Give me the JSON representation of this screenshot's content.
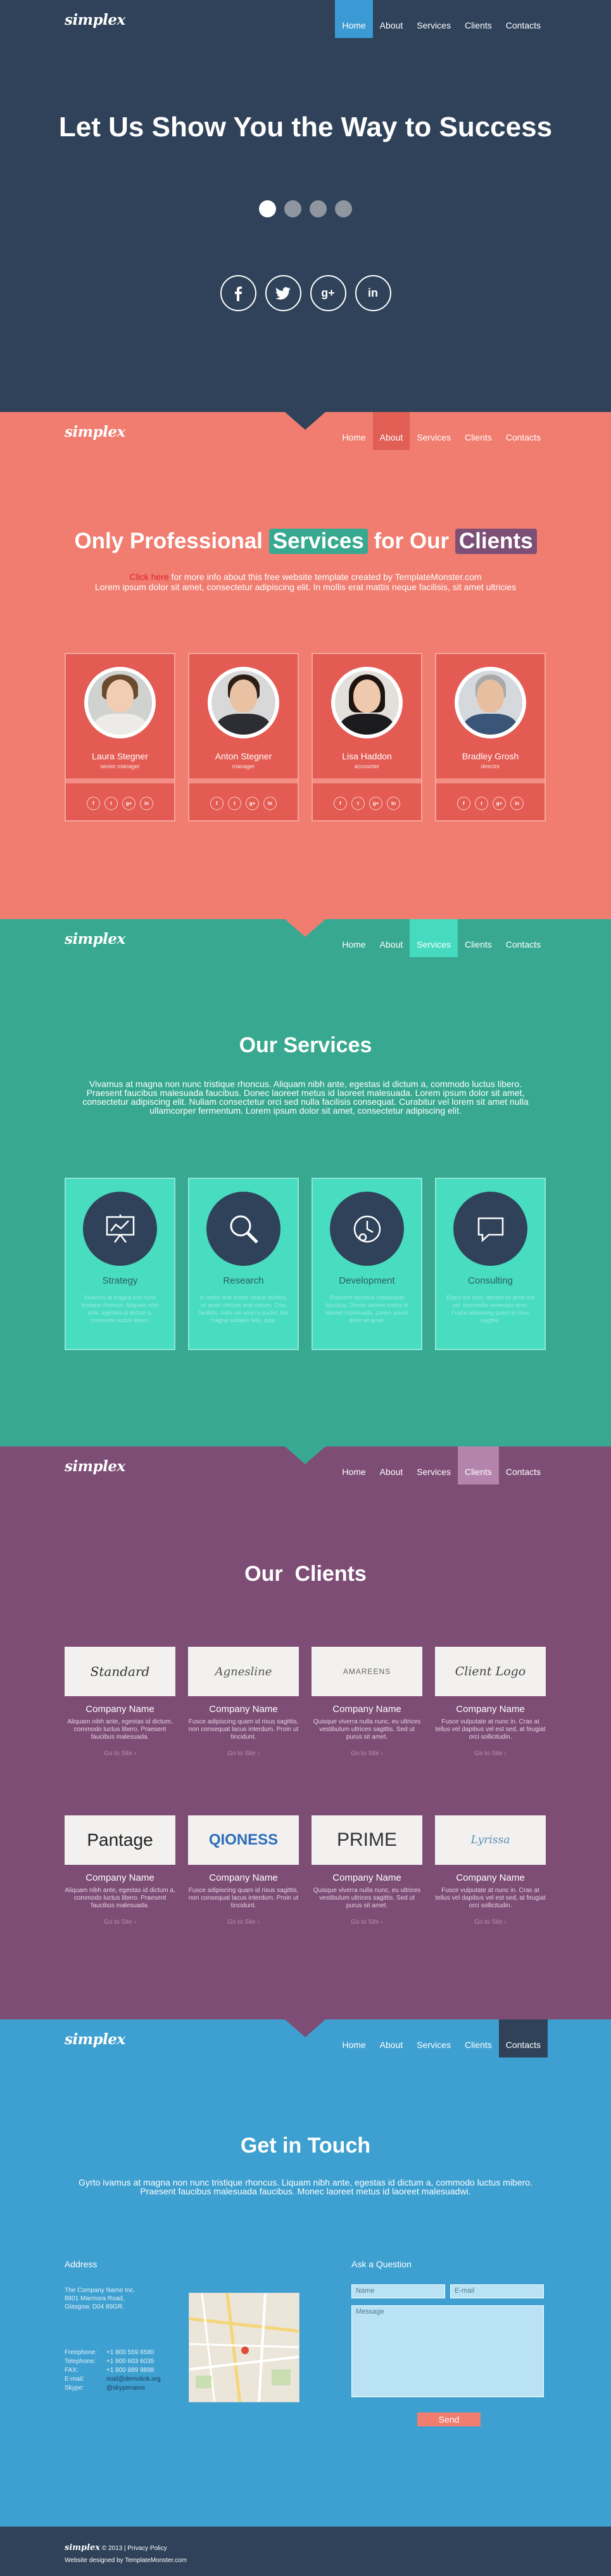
{
  "logo": "simplex",
  "nav": [
    "Home",
    "About",
    "Services",
    "Clients",
    "Contacts"
  ],
  "hero": {
    "title": "Let Us Show You the Way to Success",
    "social": [
      "f",
      "t",
      "g+",
      "in"
    ],
    "slides": 4,
    "active_slide": 1
  },
  "about": {
    "title_pre": "Only Professional ",
    "title_hl1": "Services",
    "title_mid": " for Our ",
    "title_hl2": "Clients",
    "click_here": "Click here",
    "line1": " for more info about this free website template created by TemplateMonster.com",
    "line2": "Lorem ipsum dolor sit amet, consectetur adipiscing elit. In mollis erat mattis neque facilisis, sit amet ultricies",
    "members": [
      {
        "name": "Laura Stegner",
        "role": "senior manager"
      },
      {
        "name": "Anton Stegner",
        "role": "manager"
      },
      {
        "name": "Lisa Haddon",
        "role": "accounter"
      },
      {
        "name": "Bradley Grosh",
        "role": "director"
      }
    ],
    "social": [
      "f",
      "t",
      "g+",
      "in"
    ]
  },
  "services": {
    "title": "Our Services",
    "text": "Vivamus at magna non nunc tristique rhoncus. Aliquam nibh ante, egestas id dictum a, commodo luctus libero. Praesent faucibus malesuada faucibus. Donec laoreet metus id laoreet malesuada. Lorem ipsum dolor sit amet, consectetur adipiscing elit. Nullam consectetur orci sed nulla facilisis consequat. Curabitur vel lorem sit amet nulla ullamcorper fermentum. Lorem ipsum dolor sit amet, consectetur adipiscing elit.",
    "items": [
      {
        "name": "Strategy",
        "icon": "presentation-chart-icon",
        "text": "Vivamus at magna non nunc tristique rhoncus. Aliquam nibh ante, egestas id dictum a, commodo luctus libero."
      },
      {
        "name": "Research",
        "icon": "magnifier-icon",
        "text": "In mollis erat mattis neque facilisis, sit amet ultricies erat rutrum. Cras facilisis, nulla vel viverra auctor, leo magna sodales felis, quis."
      },
      {
        "name": "Development",
        "icon": "clock-icon",
        "text": "Praesent faucibus malesuada faucibus. Donec laoreet metus id laoreet malesuada. Lorem ipsum dolor sit amet."
      },
      {
        "name": "Consulting",
        "icon": "speech-bubble-icon",
        "text": "Etiam dui eros, laoreet sit amet est vel, commodo venenatis eros. Fusce adipiscing quam id risus sagittis."
      }
    ]
  },
  "clients": {
    "title": "Our  Clients",
    "link": "Go to Site",
    "items": [
      {
        "logo": "Standard",
        "name": "Company Name",
        "text": "Aliquam nibh ante, egestas id dictum, commodo luctus libero. Praesent faucibus malesuada."
      },
      {
        "logo": "Agnesline",
        "name": "Company Name",
        "text": "Fusce adipiscing quam id risus sagittis, non consequat lacus interdum. Proin ut tincidunt."
      },
      {
        "logo": "AMAREENS",
        "name": "Company Name",
        "text": "Quisque viverra nulla nunc, eu ultrices vestibulum ultrices sagittis. Sed ut purus sit amet."
      },
      {
        "logo": "Client Logo",
        "name": "Company Name",
        "text": "Fusce vulputate at nunc in. Cras at tellus vel dapibus vel est sed, at feugiat orci sollicitudin."
      },
      {
        "logo": "Pantage",
        "name": "Company Name",
        "text": "Aliquam nibh ante, egestas id dictum a, commodo luctus libero. Praesent faucibus malesuada."
      },
      {
        "logo": "QIONESS",
        "name": "Company Name",
        "text": "Fusce adipiscing quam id risus sagittis, non consequat lacus interdum. Proin ut tincidunt."
      },
      {
        "logo": "PRIME",
        "name": "Company Name",
        "text": "Quisque viverra nulla nunc, eu ultrices vestibulum ultrices sagittis. Sed ut purus sit amet."
      },
      {
        "logo": "Lyrissa",
        "name": "Company Name",
        "text": "Fusce vulputate at nunc in. Cras at tellus vel dapibus vel est sed, at feugiat orci sollicitudin."
      }
    ]
  },
  "contacts": {
    "title": "Get in Touch",
    "text": "Gyrto ivamus at magna non nunc tristique rhoncus. Liquam nibh ante, egestas id dictum a, commodo luctus mibero. Praesent faucibus malesuada faucibus. Monec laoreet metus id laoreet malesuadwi.",
    "address_head": "Address",
    "address": [
      "The Company Name Inc.",
      "8901 Marmora Road,",
      "Glasgow, D04 89GR."
    ],
    "lines": [
      {
        "label": "Freephone:",
        "value": "+1 800 559 6580"
      },
      {
        "label": "Telephone:",
        "value": "+1 800 603 6035"
      },
      {
        "label": "FAX:",
        "value": "+1 800 889 9898"
      },
      {
        "label": "E-mail:",
        "value": "mail@demolink.org"
      },
      {
        "label": "Skype:",
        "value": "@skypename"
      }
    ],
    "form_head": "Ask a Question",
    "name_placeholder": "Name",
    "email_placeholder": "E-mail",
    "message_placeholder": "Message",
    "send": "Send"
  },
  "footer": {
    "logo": "simplex",
    "copyright": "© 2013 | Privacy Policy",
    "credit": "Website designed by TemplateMonster.com"
  },
  "colors": {
    "hero_bg": "#2f4259",
    "about_bg": "#f07d70",
    "services_bg": "#38a990",
    "clients_bg": "#7d4d76",
    "contacts_bg": "#3ea0d0"
  }
}
